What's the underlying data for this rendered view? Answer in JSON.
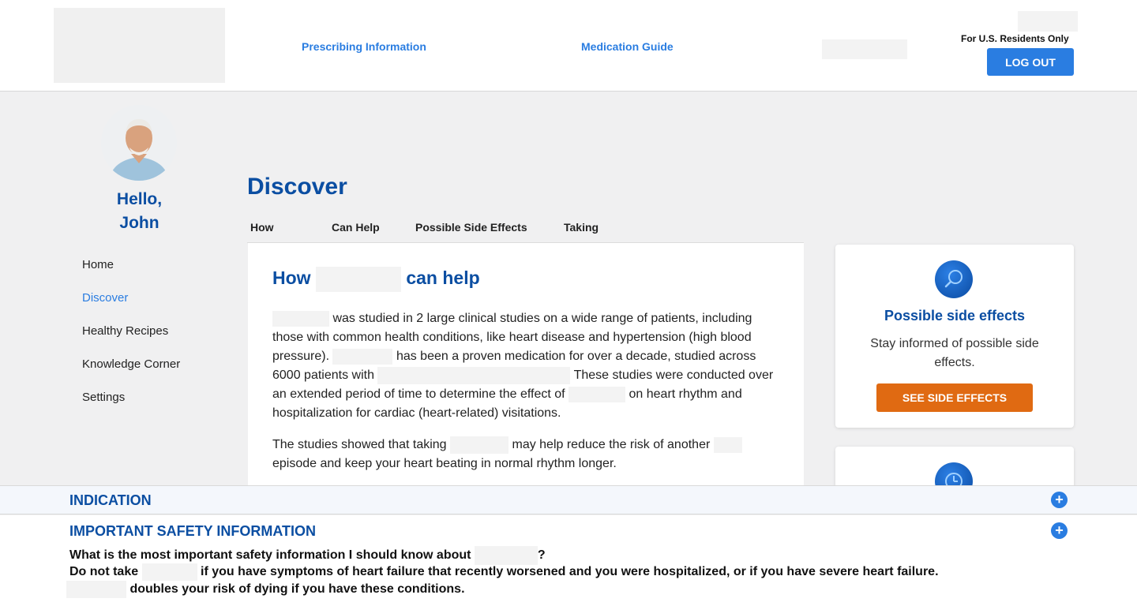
{
  "header": {
    "links": [
      "Prescribing Information",
      "Medication Guide"
    ],
    "residents": "For U.S. Residents Only",
    "logout": "LOG OUT"
  },
  "sidebar": {
    "greeting": "Hello,",
    "name": "John",
    "items": [
      {
        "label": "Home",
        "active": false
      },
      {
        "label": "Discover",
        "active": true
      },
      {
        "label": "Healthy Recipes",
        "active": false
      },
      {
        "label": "Knowledge Corner",
        "active": false
      },
      {
        "label": "Settings",
        "active": false
      }
    ]
  },
  "main": {
    "title": "Discover",
    "tabs": [
      "How",
      "Can Help",
      "Possible Side Effects",
      "Taking"
    ],
    "card": {
      "heading_pre": "How",
      "heading_post": "can help",
      "p1_a": "was studied in 2 large clinical studies on a wide range of patients, including those with common health conditions, like heart disease and hypertension (high blood pressure).",
      "p1_b": "has been a proven medication for over a decade, studied across 6000 patients with",
      "p1_c": "These studies were conducted over an extended period of time to determine the effect of",
      "p1_d": "on heart rhythm and hospitalization for cardiac (heart-related) visitations.",
      "p2_a": "The studies showed that taking",
      "p2_b": "may help reduce the risk of another",
      "p2_c": "episode and keep your heart beating in normal rhythm longer."
    }
  },
  "side_card": {
    "title": "Possible side effects",
    "desc": "Stay informed of possible side effects.",
    "button": "SEE SIDE EFFECTS"
  },
  "isi": {
    "indication": "INDICATION",
    "safety": "IMPORTANT SAFETY INFORMATION",
    "q": "What is the most important safety information I should know about",
    "line2_a": "Do not take",
    "line2_b": "if you have symptoms of heart failure that recently worsened and you were hospitalized, or if you have severe heart failure.",
    "line3": "doubles your risk of dying if you have these conditions."
  },
  "colors": {
    "brand_blue": "#0b4ea2",
    "link_blue": "#2a7de1",
    "orange": "#e06a12"
  }
}
